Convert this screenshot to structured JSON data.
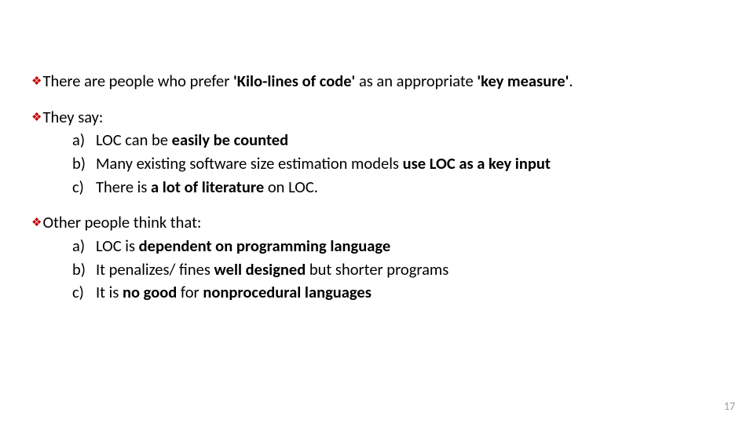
{
  "bullets": [
    {
      "lead_pre": "There are people who prefer ",
      "lead_bold1": "'Kilo-lines of code'",
      "lead_mid": " as an appropriate ",
      "lead_bold2": "'key measure'",
      "lead_post": ".",
      "items": []
    },
    {
      "lead_pre": "They say:",
      "lead_bold1": "",
      "lead_mid": "",
      "lead_bold2": "",
      "lead_post": "",
      "items": [
        {
          "pre": "LOC can be ",
          "b": "easily be counted",
          "post": ""
        },
        {
          "pre": "Many existing software size estimation models ",
          "b": "use LOC as a key input",
          "post": ""
        },
        {
          "pre": "There is ",
          "b": "a lot of literature",
          "post": " on LOC."
        }
      ]
    },
    {
      "lead_pre": "Other people think that:",
      "lead_bold1": "",
      "lead_mid": "",
      "lead_bold2": "",
      "lead_post": "",
      "items": [
        {
          "pre": "LOC is ",
          "b": "dependent on programming language",
          "post": ""
        },
        {
          "pre": "It penalizes/ fines ",
          "b": "well designed",
          "post": " but shorter programs"
        },
        {
          "pre": "It is ",
          "b": "no good",
          "post": " for ",
          "b2": "nonprocedural languages",
          "post2": ""
        }
      ]
    }
  ],
  "page_number": "17"
}
